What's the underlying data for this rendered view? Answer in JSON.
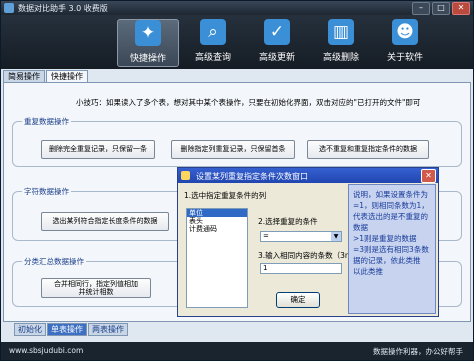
{
  "window": {
    "title": "数据对比助手 3.0 收费版",
    "min_label": "–",
    "max_label": "□",
    "close_label": "✕"
  },
  "toolbar": {
    "items": [
      {
        "label": "快捷操作",
        "icon": "lightning-icon",
        "glyph": "✦"
      },
      {
        "label": "高级查询",
        "icon": "search-icon",
        "glyph": "⌕"
      },
      {
        "label": "高级更新",
        "icon": "checkmark-icon",
        "glyph": "✓"
      },
      {
        "label": "高级删除",
        "icon": "trash-icon",
        "glyph": "▥"
      },
      {
        "label": "关于软件",
        "icon": "people-icon",
        "glyph": "☻"
      }
    ]
  },
  "tabs": [
    "简易操作",
    "快捷操作"
  ],
  "tip": "小技巧：如果读入了多个表，想对其中某个表操作，只要在初始化界面，双击对应的\"已打开的文件\"即可",
  "groups": {
    "duplicate": {
      "title": "重复数据操作",
      "buttons": [
        "删除完全重复记录，只保留一条",
        "删除指定列重复记录，只保留首条",
        "选不重复和重复指定条件的数据"
      ]
    },
    "character": {
      "title": "字符数据操作",
      "buttons": [
        "选出某列符合指定长度条件的数据"
      ]
    },
    "summary": {
      "title": "分类汇总数据操作",
      "button_line1": "合并相同行，指定列值相加",
      "button_line2": "并统计相数"
    }
  },
  "bottom_tabs": [
    "初始化",
    "单表操作",
    "两表操作"
  ],
  "status": {
    "url": "www.sbsjudubi.com",
    "right": "数据操作利器，办公好帮手"
  },
  "dialog": {
    "title": "设置某列重复指定条件次数窗口",
    "close_label": "✕",
    "step1": "1.选中指定重复条件的列",
    "list_items": [
      "单位",
      "表头",
      "计费通码"
    ],
    "selected_index": 0,
    "step2": "2.选择重复的条件",
    "condition_value": "=",
    "step3": "3.输入相同内容的条数（3n）",
    "count_value": "1",
    "ok_label": "确定",
    "description": [
      "说明，如果设置条件为 =1，则相同条数为1，代表选出的是不重复的数据",
      ">1则是重复的数据",
      "=3则是选有相同3条数据的记录，依此类推",
      "以此类推"
    ]
  }
}
